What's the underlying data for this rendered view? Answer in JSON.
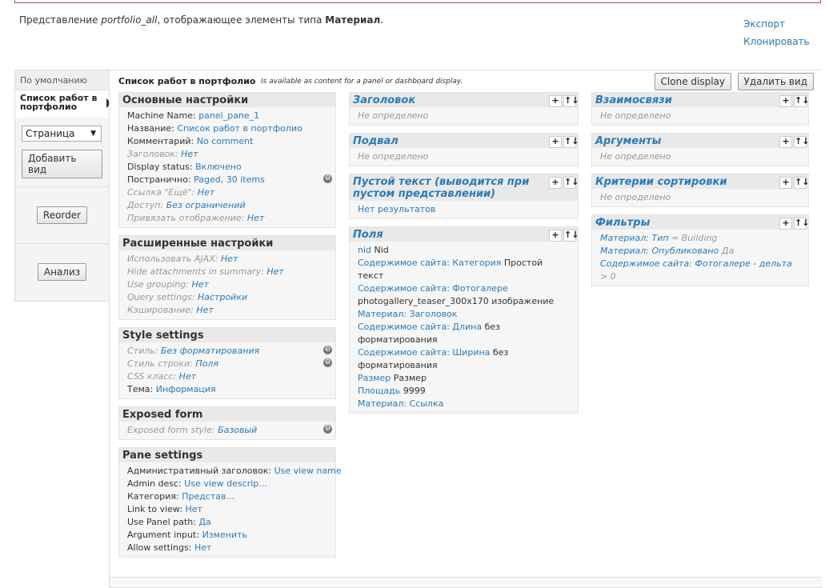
{
  "description": {
    "prefix": "Представление ",
    "view_name": "portfolio_all",
    "middle": ", отображающее элементы типа ",
    "type": "Материал",
    "suffix": "."
  },
  "links": {
    "export": "Экспорт",
    "clone": "Клонировать"
  },
  "tabs": {
    "default": "По умолчанию",
    "current": "Список работ в портфолио",
    "select_value": "Страница",
    "add_view": "Добавить вид",
    "reorder": "Reorder",
    "analyze": "Анализ"
  },
  "display": {
    "title": "Список работ в портфолио",
    "note": "Is available as content for a panel or dashboard display.",
    "clone_btn": "Clone display",
    "delete_btn": "Удалить вид"
  },
  "basic": {
    "title": "Основные настройки",
    "rows": [
      {
        "label": "Machine Name:",
        "value": "panel_pane_1",
        "dim": false
      },
      {
        "label": "Название:",
        "value": "Список работ в портфолио",
        "dim": false
      },
      {
        "label": "Комментарий:",
        "value": "No comment",
        "dim": false
      },
      {
        "label": "Заголовок:",
        "value": "Нет",
        "dim": true
      },
      {
        "label": "Display status:",
        "value": "Включено",
        "dim": false
      },
      {
        "label": "Постранично:",
        "value": "Paged, 30 items",
        "dim": false,
        "gear": true
      },
      {
        "label": "Ссылка \"Ещё\":",
        "value": "Нет",
        "dim": true
      },
      {
        "label": "Доступ:",
        "value": "Без ограничений",
        "dim": true
      },
      {
        "label": "Привязать отображение:",
        "value": "Нет",
        "dim": true
      }
    ]
  },
  "advanced": {
    "title": "Расширенные настройки",
    "rows": [
      {
        "label": "Использовать AJAX:",
        "value": "Нет",
        "dim": true
      },
      {
        "label": "Hide attachments in summary:",
        "value": "Нет",
        "dim": true
      },
      {
        "label": "Use grouping:",
        "value": "Нет",
        "dim": true
      },
      {
        "label": "Query settings:",
        "value": "Настройки",
        "dim": true
      },
      {
        "label": "Кэширование:",
        "value": "Нет",
        "dim": true
      }
    ]
  },
  "style": {
    "title": "Style settings",
    "rows": [
      {
        "label": "Стиль:",
        "value": "Без форматирования",
        "dim": true,
        "gear": true
      },
      {
        "label": "Стиль строки:",
        "value": "Поля",
        "dim": true,
        "gear": true
      },
      {
        "label": "CSS класс:",
        "value": "Нет",
        "dim": true
      },
      {
        "label": "Тема:",
        "value": "Информация",
        "dim": false
      }
    ]
  },
  "exposed": {
    "title": "Exposed form",
    "rows": [
      {
        "label": "Exposed form style:",
        "value": "Базовый",
        "dim": true,
        "gear": true
      }
    ]
  },
  "pane": {
    "title": "Pane settings",
    "rows": [
      {
        "label": "Административный заголовок:",
        "value": "Use view name",
        "dim": false
      },
      {
        "label": "Admin desc:",
        "value": "Use view descrip...",
        "dim": false
      },
      {
        "label": "Категория:",
        "value": "Представ...",
        "dim": false
      },
      {
        "label": "Link to view:",
        "value": "Нет",
        "dim": false
      },
      {
        "label": "Use Panel path:",
        "value": "Да",
        "dim": false
      },
      {
        "label": "Argument input:",
        "value": "Изменить",
        "dim": false
      },
      {
        "label": "Allow settings:",
        "value": "Нет",
        "dim": false
      }
    ]
  },
  "header": {
    "title": "Заголовок",
    "empty": "Не определено"
  },
  "footer": {
    "title": "Подвал",
    "empty": "Не определено"
  },
  "empty_text": {
    "title": "Пустой текст (выводится при пустом представлении)",
    "value": "Нет результатов"
  },
  "fields": {
    "title": "Поля",
    "rows": [
      {
        "link": "nid",
        "text": " Nid"
      },
      {
        "link": "Содержимое сайта: Категория",
        "text": " Простой текст"
      },
      {
        "link": "Содержимое сайта: Фотогалере",
        "text": ""
      },
      {
        "link": "",
        "text": "photogallery_teaser_300x170 изображение"
      },
      {
        "link": "Материал: Заголовок",
        "text": ""
      },
      {
        "link": "Содержимое сайта: Длина",
        "text": " без форматирования"
      },
      {
        "link": "Содержимое сайта: Ширина",
        "text": " без форматирования"
      },
      {
        "link": "Размер",
        "text": " Размер"
      },
      {
        "link": "Площадь",
        "text": " 9999"
      },
      {
        "link": "Материал: Ссылка",
        "text": ""
      }
    ]
  },
  "relations": {
    "title": "Взаимосвязи",
    "empty": "Не определено"
  },
  "arguments": {
    "title": "Аргументы",
    "empty": "Не определено"
  },
  "sorts": {
    "title": "Критерии сортировки",
    "empty": "Не определено"
  },
  "filters": {
    "title": "Фильтры",
    "rows": [
      {
        "link": "Материал: Тип",
        "text": " = Building"
      },
      {
        "link": "Материал: Опубликовано",
        "text": " Да"
      },
      {
        "link": "Содержимое сайта: Фотогалере - дельта",
        "text": " > 0"
      }
    ]
  },
  "controls": {
    "add": "+",
    "rearrange": "↑↓"
  }
}
